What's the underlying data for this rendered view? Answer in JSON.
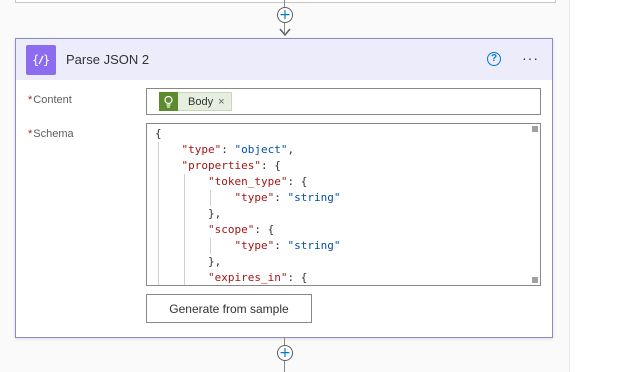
{
  "card": {
    "title": "Parse JSON 2",
    "help_symbol": "?",
    "more_symbol": "···"
  },
  "fields": {
    "content_label": "Content",
    "schema_label": "Schema",
    "required_marker": "*"
  },
  "content_token": {
    "label": "Body",
    "remove": "×"
  },
  "schema_lines": [
    "{",
    "    \"type\": \"object\",",
    "    \"properties\": {",
    "        \"token_type\": {",
    "            \"type\": \"string\"",
    "        },",
    "        \"scope\": {",
    "            \"type\": \"string\"",
    "        },",
    "        \"expires_in\": {"
  ],
  "generate_button": "Generate from sample",
  "add_symbol": "+",
  "colors": {
    "header_bg": "#ececfb",
    "action_icon_bg": "#8c6cef",
    "token_icon_bg": "#5b8a2f",
    "accent": "#0078d4"
  },
  "icons": {
    "action": "curly-braces-icon",
    "token": "lightbulb-icon"
  }
}
